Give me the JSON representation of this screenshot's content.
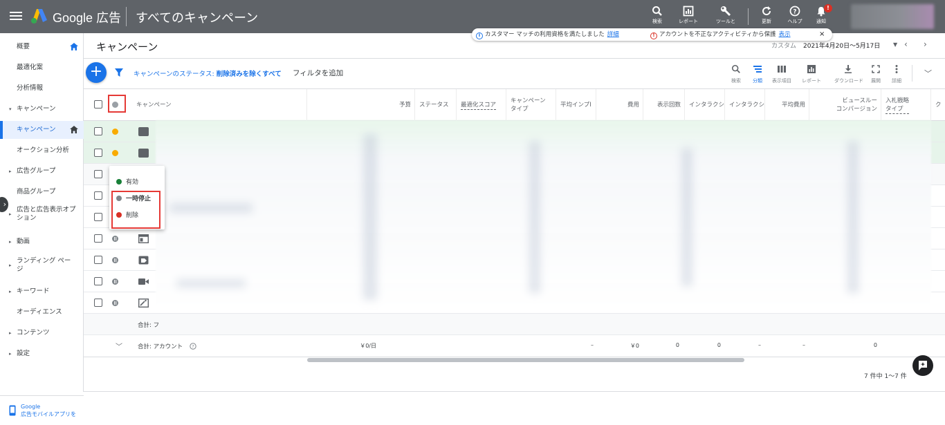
{
  "header": {
    "brand": "Google 広告",
    "page_heading": "すべてのキャンペーン",
    "tools": [
      {
        "label": "検索",
        "icon": "search-icon"
      },
      {
        "label": "レポート",
        "icon": "reports-icon"
      },
      {
        "label": "ツールと",
        "icon": "wrench-icon"
      },
      {
        "label": "更新",
        "icon": "refresh-icon"
      },
      {
        "label": "ヘルプ",
        "icon": "help-icon"
      },
      {
        "label": "通知",
        "icon": "bell-icon",
        "badge": "!"
      }
    ]
  },
  "sidebar": {
    "items": [
      {
        "label": "概要",
        "home": true
      },
      {
        "label": "最適化案"
      },
      {
        "label": "分析情報"
      },
      {
        "label": "キャンペーン",
        "caret": "▾"
      },
      {
        "label": "キャンペーン",
        "active": true,
        "home": true
      },
      {
        "label": "オークション分析"
      },
      {
        "label": "広告グループ",
        "caret": "▸"
      },
      {
        "label": "商品グループ"
      },
      {
        "label": "広告と広告表示オプション",
        "caret": "▸"
      },
      {
        "label": "動画",
        "caret": "▸"
      },
      {
        "label": "ランディング ページ",
        "caret": "▸"
      },
      {
        "label": "キーワード",
        "caret": "▸"
      },
      {
        "label": "オーディエンス"
      },
      {
        "label": "コンテンツ",
        "caret": "▸"
      },
      {
        "label": "設定",
        "caret": "▸"
      }
    ],
    "footer_line1": "Google",
    "footer_line2": "広告モバイルアプリを"
  },
  "main": {
    "title": "キャンペーン",
    "date_label": "カスタム",
    "date_range": "2021年4月20日～5月17日"
  },
  "notice": {
    "text1": "カスタマー マッチの利用資格を満たしました",
    "link1": "詳細",
    "text2": "アカウントを不正なアクティビティから保護",
    "link2": "表示",
    "close": "×"
  },
  "filter": {
    "prefix": "キャンペーンのステータス: ",
    "value": "削除済みを除くすべて",
    "add": "フィルタを追加"
  },
  "table_tools": [
    {
      "label": "検索",
      "icon": "search-icon"
    },
    {
      "label": "分類",
      "icon": "segment-icon",
      "active": true
    },
    {
      "label": "表示項目",
      "icon": "columns-icon"
    },
    {
      "label": "レポート",
      "icon": "reports-icon"
    },
    {
      "label": "ダウンロード",
      "icon": "download-icon"
    },
    {
      "label": "展開",
      "icon": "fullscreen-icon"
    },
    {
      "label": "詳細",
      "icon": "more-icon"
    }
  ],
  "columns": {
    "campaign": "キャンペーン",
    "budget": "予算",
    "status": "ステータス",
    "opt_score": "最適化スコア",
    "type1": "キャンペーン",
    "type2": "タイプ",
    "avg_imp": "平均インプI",
    "cost": "費用",
    "impressions": "表示回数",
    "interact1": "インタラクシ",
    "interact2": "インタラクシ",
    "avg_cost": "平均費用",
    "viewthrough1": "ビュースルー",
    "viewthrough2": "コンバージョン",
    "bid1": "入札戦略",
    "bid2": "タイプ",
    "last": "ク"
  },
  "rows": [
    {
      "status": "warning",
      "type_icon": "search-campaign-icon"
    },
    {
      "status": "warning",
      "type_icon": "search-campaign-icon"
    },
    {
      "status": "paused",
      "type_icon": "blank"
    },
    {
      "status": "paused",
      "type_icon": "blank"
    },
    {
      "status": "paused",
      "type_icon": "blank"
    },
    {
      "status": "paused",
      "type_icon": "display-campaign-icon"
    },
    {
      "status": "paused",
      "type_icon": "shopping-campaign-icon"
    },
    {
      "status": "paused",
      "type_icon": "video-campaign-icon"
    },
    {
      "status": "paused",
      "type_icon": "smart-campaign-icon"
    }
  ],
  "totals": {
    "filtered_label": "合計: フ",
    "account_label": "合計: アカウント",
    "budget": "￥0/日",
    "avg_imp": "–",
    "cost": "￥0",
    "impressions": "0",
    "interactions": "0",
    "interaction_rate": "–",
    "avg_cost": "–",
    "viewthrough": "0"
  },
  "status_menu": {
    "items": [
      {
        "label": "有効",
        "color": "#188038"
      },
      {
        "label": "一時停止",
        "color": "#80868b"
      },
      {
        "label": "削除",
        "color": "#d93025"
      }
    ]
  },
  "pager": "7 件中 1～7 件"
}
